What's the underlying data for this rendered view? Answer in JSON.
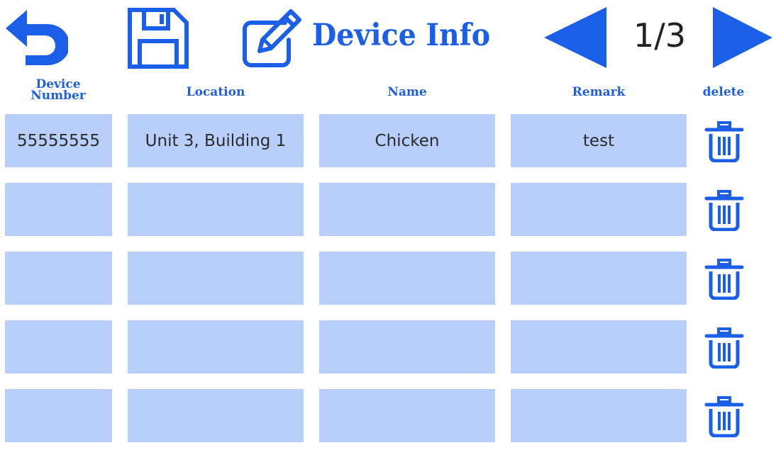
{
  "header": {
    "title": "Device Info",
    "page_indicator": "1/3",
    "back_icon": "undo-arrow-icon",
    "save_icon": "floppy-disk-icon",
    "edit_icon": "pencil-square-icon",
    "prev_icon": "triangle-left-icon",
    "next_icon": "triangle-right-icon"
  },
  "table": {
    "headers": {
      "device_number_line1": "Device",
      "device_number_line2": "Number",
      "location": "Location",
      "name": "Name",
      "remark": "Remark",
      "delete": "delete"
    },
    "rows": [
      {
        "device_number": "55555555",
        "location": "Unit 3, Building 1",
        "name": "Chicken",
        "remark": "test"
      },
      {
        "device_number": "",
        "location": "",
        "name": "",
        "remark": ""
      },
      {
        "device_number": "",
        "location": "",
        "name": "",
        "remark": ""
      },
      {
        "device_number": "",
        "location": "",
        "name": "",
        "remark": ""
      },
      {
        "device_number": "",
        "location": "",
        "name": "",
        "remark": ""
      }
    ],
    "delete_icon": "trash-can-icon"
  },
  "colors": {
    "accent": "#1b5ee8",
    "cell_background": "#b8cffb",
    "text": "#2a2a2a"
  }
}
